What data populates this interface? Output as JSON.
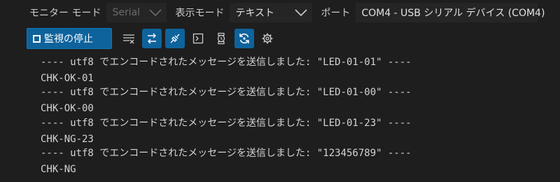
{
  "toolbar": {
    "monitor_mode_label": "モニター モード",
    "monitor_mode_value": "Serial",
    "view_mode_label": "表示モード",
    "view_mode_value": "テキスト",
    "port_label": "ポート",
    "port_value": "COM4 - USB シリアル デバイス (COM4)",
    "stop_button_label": "監視の停止"
  },
  "icons": {
    "clear": "clear-output-icon",
    "toggle_line_ending": "line-ending-toggle-icon",
    "connect": "plug-icon",
    "terminal": "terminal-icon",
    "timestamp": "stopwatch-icon",
    "auto_scroll": "auto-reconnect-icon",
    "settings": "gear-icon"
  },
  "colors": {
    "accent": "#0e639c",
    "background": "#1e1e1e"
  },
  "output": {
    "lines": [
      "---- utf8 でエンコードされたメッセージを送信しました: \"LED-01-01\" ----",
      "CHK-OK-01",
      "---- utf8 でエンコードされたメッセージを送信しました: \"LED-01-00\" ----",
      "CHK-OK-00",
      "---- utf8 でエンコードされたメッセージを送信しました: \"LED-01-23\" ----",
      "CHK-NG-23",
      "---- utf8 でエンコードされたメッセージを送信しました: \"123456789\" ----",
      "CHK-NG"
    ]
  }
}
